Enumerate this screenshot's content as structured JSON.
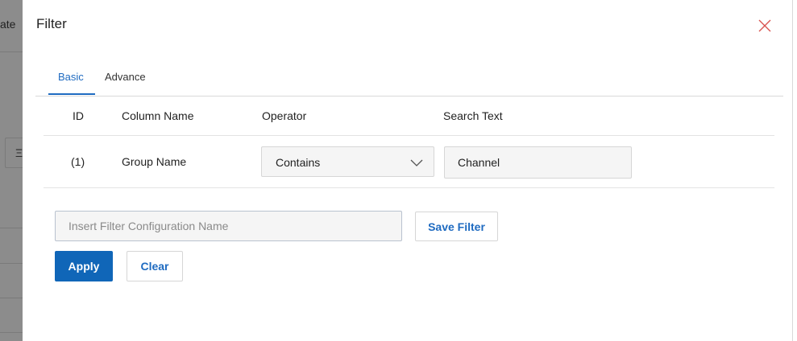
{
  "background": {
    "partial_text": "ate",
    "partial_icon": "Ξ"
  },
  "modal": {
    "title": "Filter",
    "close_icon": "close-icon"
  },
  "tabs": [
    {
      "label": "Basic",
      "active": true
    },
    {
      "label": "Advance",
      "active": false
    }
  ],
  "table": {
    "headers": {
      "id": "ID",
      "column_name": "Column Name",
      "operator": "Operator",
      "search_text": "Search Text"
    },
    "rows": [
      {
        "id": "(1)",
        "column_name": "Group Name",
        "operator": "Contains",
        "search_text": "Channel"
      }
    ]
  },
  "config": {
    "placeholder": "Insert Filter Configuration Name",
    "value": "",
    "save_label": "Save Filter"
  },
  "actions": {
    "apply_label": "Apply",
    "clear_label": "Clear"
  },
  "colors": {
    "accent": "#1F6BC1",
    "primary_button": "#1066B8",
    "close_icon": "#D9534F",
    "overlay": "#8C8C8C"
  }
}
